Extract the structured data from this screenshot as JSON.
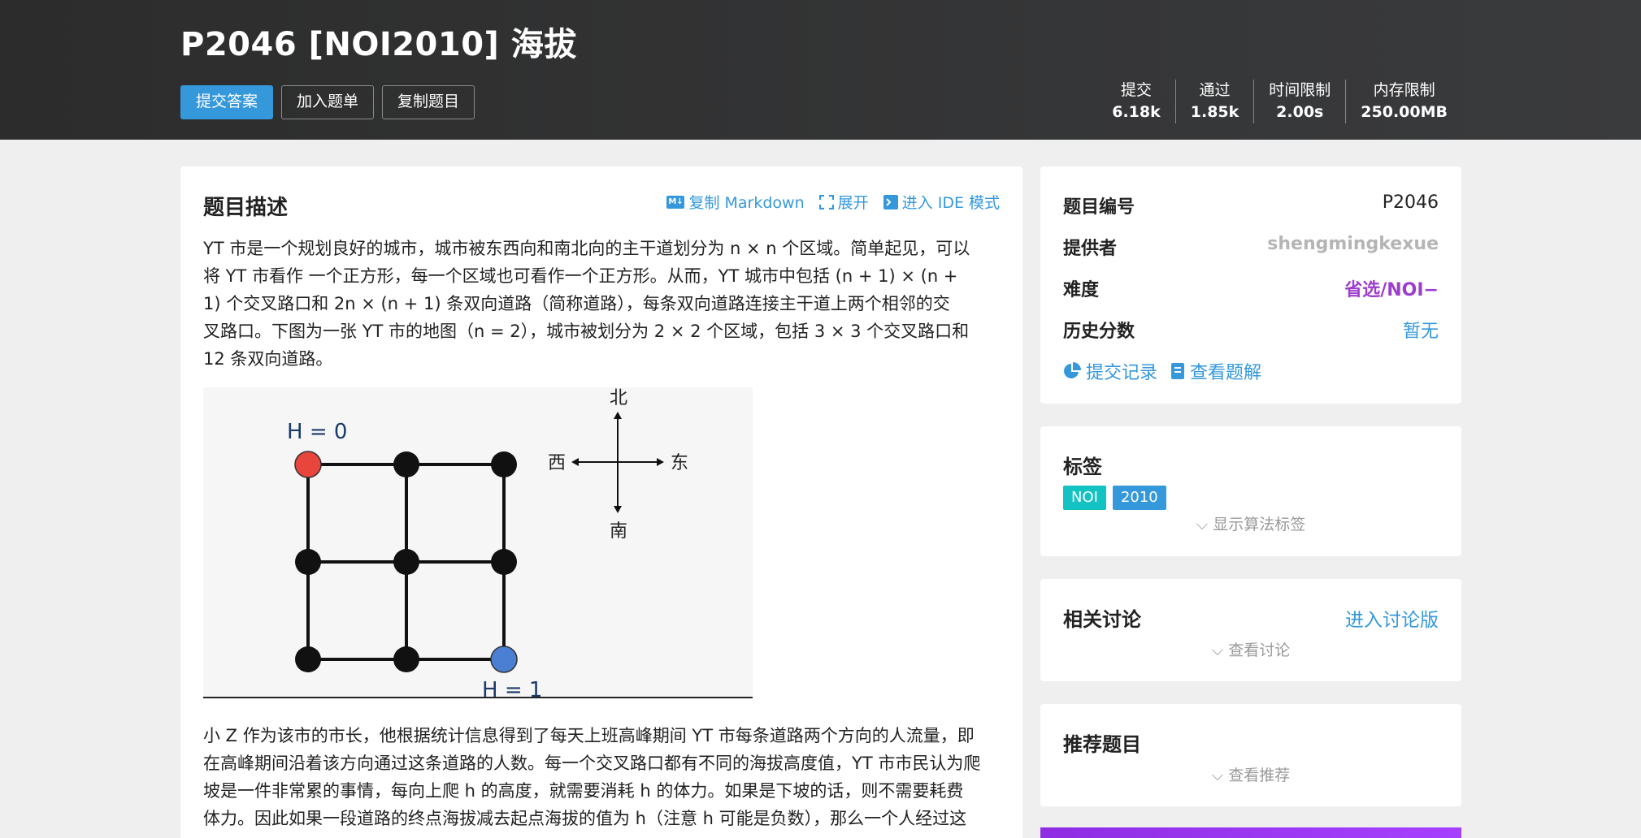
{
  "problem": {
    "title": "P2046 [NOI2010] 海拔",
    "buttons": {
      "submit": "提交答案",
      "add_list": "加入题单",
      "copy": "复制题目"
    },
    "stats": [
      {
        "label": "提交",
        "value": "6.18k"
      },
      {
        "label": "通过",
        "value": "1.85k"
      },
      {
        "label": "时间限制",
        "value": "2.00s"
      },
      {
        "label": "内存限制",
        "value": "250.00MB"
      }
    ]
  },
  "description": {
    "title": "题目描述",
    "actions": {
      "copy_md": "复制 Markdown",
      "expand": "展开",
      "ide": "进入 IDE 模式"
    },
    "para1": [
      "YT 市是一个规划良好的城市，城市被东西向和南北向的主干道划分为 n × n 个区域。简单起见，可以",
      "将 YT 市看作 一个正方形，每一个区域也可看作一个正方形。从而，YT 城市中包括 (n + 1) × (n +",
      "1) 个交叉路口和 2n × (n + 1) 条双向道路（简称道路），每条双向道路连接主干道上两个相邻的交",
      "叉路口。下图为一张 YT 市的地图（n = 2），城市被划分为 2 × 2 个区域，包括 3 × 3 个交叉路口和",
      "12 条双向道路。"
    ],
    "para2": [
      "小 Z 作为该市的市长，他根据统计信息得到了每天上班高峰期间 YT 市每条道路两个方向的人流量，即",
      "在高峰期间沿着该方向通过这条道路的人数。每一个交叉路口都有不同的海拔高度值，YT 市市民认为爬",
      "坡是一件非常累的事情，每向上爬 h 的高度，就需要消耗 h 的体力。如果是下坡的话，则不需要耗费",
      "体力。因此如果一段道路的终点海拔减去起点海拔的值为 h（注意 h 可能是负数），那么一个人经过这"
    ],
    "figure": {
      "h0": "H = 0",
      "h1": "H = 1",
      "north": "北",
      "south": "南",
      "west": "西",
      "east": "东"
    }
  },
  "info": {
    "id_label": "题目编号",
    "id_value": "P2046",
    "provider_label": "提供者",
    "provider_value": "shengmingkexue",
    "difficulty_label": "难度",
    "difficulty_value": "省选/NOI−",
    "history_label": "历史分数",
    "history_value": "暂无",
    "records_link": "提交记录",
    "solutions_link": "查看题解"
  },
  "tags": {
    "title": "标签",
    "items": [
      {
        "label": "NOI",
        "color": "#13c2c2"
      },
      {
        "label": "2010",
        "color": "#3498db"
      }
    ],
    "show_algo": "显示算法标签"
  },
  "discussion": {
    "title": "相关讨论",
    "link": "进入讨论版",
    "view": "查看讨论"
  },
  "recommend": {
    "title": "推荐题目",
    "view": "查看推荐"
  }
}
